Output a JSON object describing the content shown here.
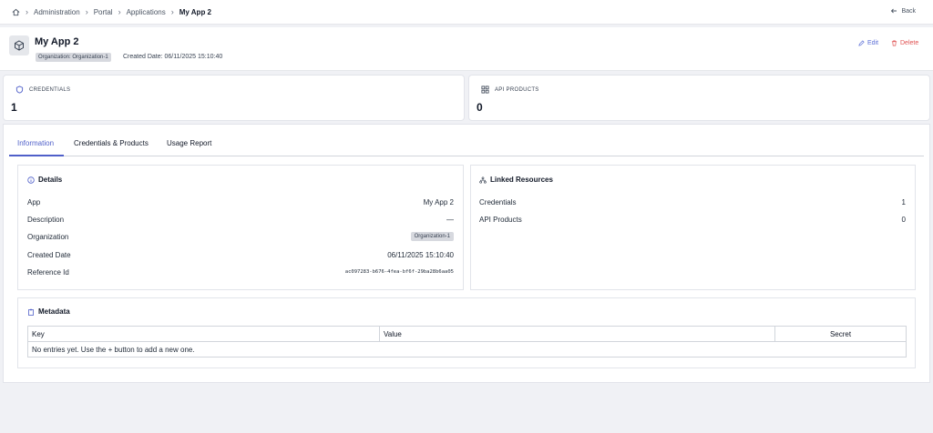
{
  "breadcrumb": {
    "items": [
      "Administration",
      "Portal",
      "Applications",
      "My App 2"
    ],
    "back_label": "Back"
  },
  "app": {
    "title": "My App 2",
    "org_badge": "Organization: Organization-1",
    "created": "Created Date: 06/11/2025 15:10:40",
    "edit_label": "Edit",
    "delete_label": "Delete"
  },
  "stats": [
    {
      "label": "CREDENTIALS",
      "value": "1",
      "icon": "shield-icon"
    },
    {
      "label": "API PRODUCTS",
      "value": "0",
      "icon": "grid-icon"
    }
  ],
  "tabs": [
    {
      "label": "Information",
      "active": true
    },
    {
      "label": "Credentials & Products",
      "active": false
    },
    {
      "label": "Usage Report",
      "active": false
    }
  ],
  "details": {
    "title": "Details",
    "rows": [
      {
        "label": "App",
        "value": "My App 2"
      },
      {
        "label": "Description",
        "value": "—"
      },
      {
        "label": "Organization",
        "value": "Organization-1"
      },
      {
        "label": "Created Date",
        "value": "06/11/2025 15:10:40"
      },
      {
        "label": "Reference Id",
        "value": "ac097283-b676-4fea-bf6f-29ba28b6aa05"
      }
    ]
  },
  "linked": {
    "title": "Linked Resources",
    "rows": [
      {
        "label": "Credentials",
        "value": "1"
      },
      {
        "label": "API Products",
        "value": "0"
      }
    ]
  },
  "metadata": {
    "title": "Metadata",
    "columns": [
      "Key",
      "Value",
      "Secret"
    ],
    "empty_text": "No entries yet. Use the + button to add a new one."
  },
  "colors": {
    "accent": "#4f5fc9",
    "danger": "#e05252",
    "page_bg": "#f0f1f5"
  }
}
